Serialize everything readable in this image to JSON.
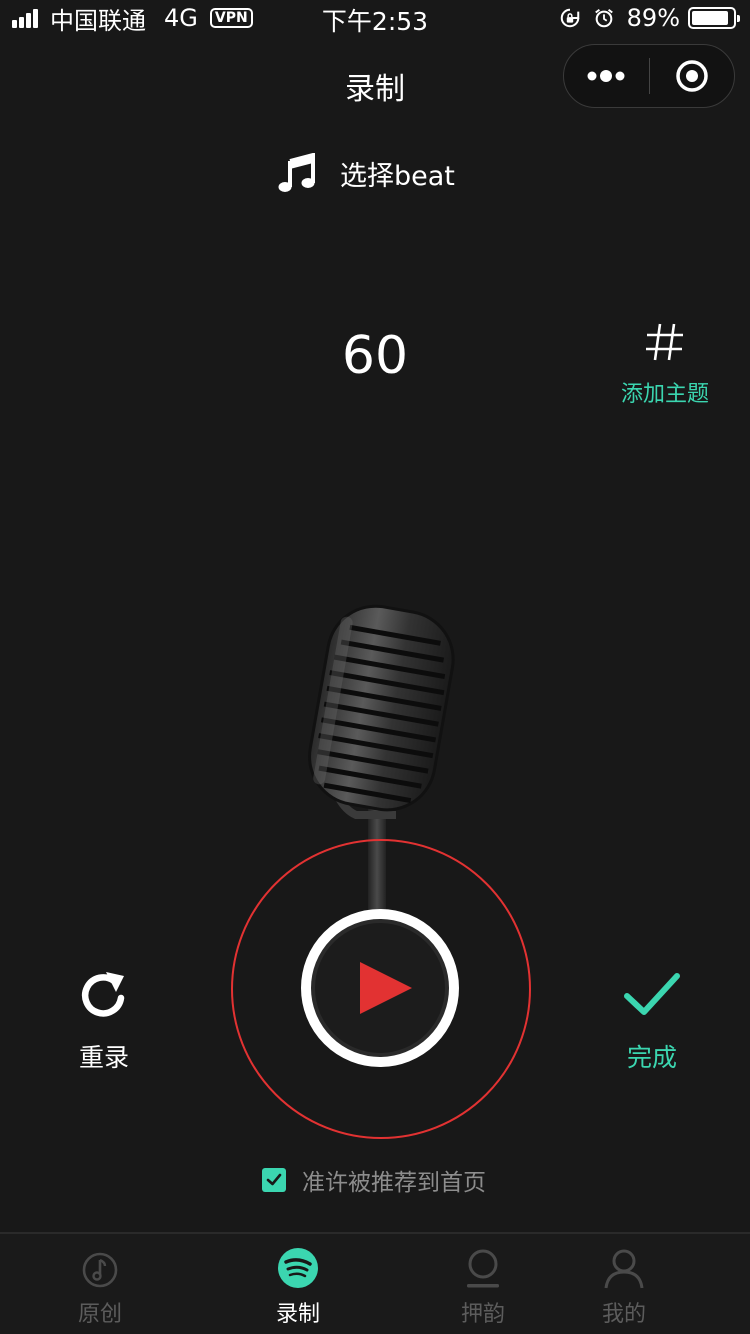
{
  "status_bar": {
    "carrier": "中国联通",
    "network": "4G",
    "vpn": "VPN",
    "time": "下午2:53",
    "battery_text": "89%",
    "battery_level": 0.89
  },
  "nav": {
    "title": "录制"
  },
  "beat": {
    "label": "选择beat",
    "icon": "music-note-icon"
  },
  "timer": {
    "value": "60"
  },
  "topic": {
    "label": "添加主题",
    "icon": "hash-icon"
  },
  "controls": {
    "rerecord_label": "重录",
    "done_label": "完成"
  },
  "recommend": {
    "label": "准许被推荐到首页",
    "checked": true
  },
  "tabs": [
    {
      "label": "原创",
      "icon": "disc-note-icon",
      "active": false
    },
    {
      "label": "录制",
      "icon": "spotify-like-icon",
      "active": true
    },
    {
      "label": "押韵",
      "icon": "rhyme-icon",
      "active": false
    },
    {
      "label": "我的",
      "icon": "profile-icon",
      "active": false
    }
  ],
  "colors": {
    "background": "#181818",
    "accent": "#3bd6b0",
    "record_red": "#e23232"
  }
}
